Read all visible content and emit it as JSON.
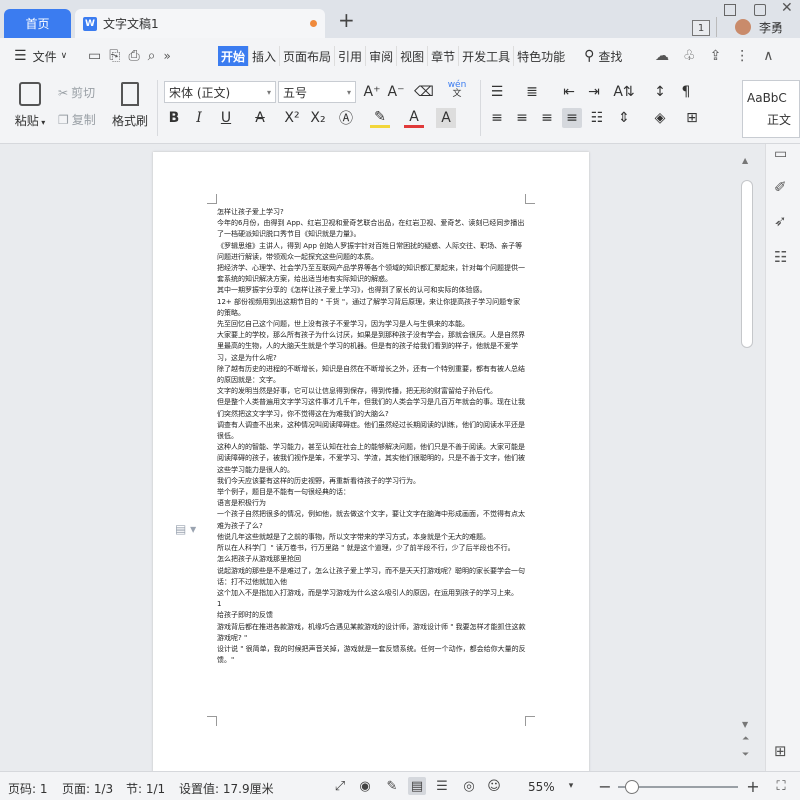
{
  "tabs": {
    "home": "首页",
    "doc_title": "文字文稿1",
    "new_tab": "+"
  },
  "account": {
    "count": "1",
    "user_name": "李勇"
  },
  "menu": {
    "file": "文件",
    "items": [
      "开始",
      "插入",
      "页面布局",
      "引用",
      "审阅",
      "视图",
      "章节",
      "开发工具",
      "特色功能"
    ],
    "search": "查找"
  },
  "ribbon": {
    "paste": "粘贴",
    "cut": "剪切",
    "copy": "复制",
    "format_painter": "格式刷",
    "font_name": "宋体 (正文)",
    "font_size": "五号",
    "wen": "wén",
    "style_preview": "AaBbC",
    "style_name": "正文"
  },
  "document": {
    "text": "怎样让孩子爱上学习?\n今年的6月份，由得到 App、红岩卫视和爱奇艺联合出品，在红岩卫视、爱奇艺、读刻已经同步播出了一档硬派知识脱口秀节目《知识就是力量》。\n《罗辑思维》主讲人，得到 App 创始人罗振宇针对百姓日常困扰的疑惑、人际交往、职场、亲子等问题进行解读，带领观众一起探究这些问题的本质。\n把经济学、心理学、社会学乃至互联网产品学界等各个领域的知识都汇聚起来，针对每个问题提供一套系统的知识解决方案，给出适当地有实际知识的解惑。\n其中一期罗振宇分享的《怎样让孩子爱上学习》，也得到了家长的认可和实际的体验感。\n12+ 部份视频用到出这期节目的 \" 干货 \"，通过了解学习背后原理，来让你提高孩子学习问题专家的策略。\n先至回忆自己这个问题，世上没有孩子不爱学习，因为学习是人与生俱来的本能。\n大家要上的学校，那么所有孩子为什么讨厌，如果是到那种孩子没有学会，那就会很厌。人是自然界里最高的生物，人的大脑天生就是个学习的机器。但是有的孩子给我们看到的样子，他就是不爱学习，这是为什么呢?\n除了越有历史的进程的不断增长，知识是自然在不断增长之外，还有一个特别重要，都有有被人总结的原因就是：文字。\n文字的发明当然是好事，它可以让信息得到保存，得到传播，把无形的财富留给子孙后代。\n但是整个人类普遍用文字学习这件事才几千年，但我们的人类会学习是几百万年就会的事。现在让我们突然把这文字学习，你不觉得这在为难我们的大脑么?\n调查有人调查不出来，这种情况叫阅读障碍症。他们虽然经过长期阅读的训练，他们的阅读水平还是很低。\n这种人的的智能、学习能力，甚至认知在社会上的能够解决问题，他们只是不善于阅读。大家可能是阅读障碍的孩子，被我们视作是笨，不爱学习、学渣，其实他们很聪明的，只是不善于文字，他们被这些学习能力是很人的。\n我们今天应该要有这样的历史视野，再重新看待孩子的学习行为。\n举个例子，题目是不能有一句很经典的话：\n语言是积极行为\n一个孩子自然把很多的情况，例如他，就去做这个文字，要让文字在脑海中形成画面，不觉得有点太难为孩子了么?\n他说几年这些就越是了之前的事物，所以文字带来的学习方式，本身就是个无大的难题。\n所以在人科学门  \" 读万卷书，行万里路 \" 就是这个道理，少了前半段不行，少了后半段也不行。\n怎么把孩子从游戏那里抢回\n说起游戏的那些是不是难过了，怎么让孩子爱上学习，而不是天天打游戏呢？聪明的家长要学会一句话：打不过他就加入他\n这个加入不是指加入打游戏，而是学习游戏为什么这么吸引人的原因，在运用到孩子的学习上来。\n1\n给孩子即时的反馈\n游戏背后都在推进各款游戏，机缘巧合遇见某款游戏的设计师，游戏设计师 \" 我要怎样才能抓住这款游戏呢? \"\n设计说 \" 很简单，我的时候把声音关掉，游戏就是一套反馈系统。任何一个动作，都会给你大量的反馈。\""
  },
  "statusbar": {
    "page_label": "页码: 1",
    "pages": "页面: 1/3",
    "section": "节: 1/1",
    "setting": "设置值: 17.9厘米",
    "zoom": "55%",
    "zoom_level": 0.55
  }
}
